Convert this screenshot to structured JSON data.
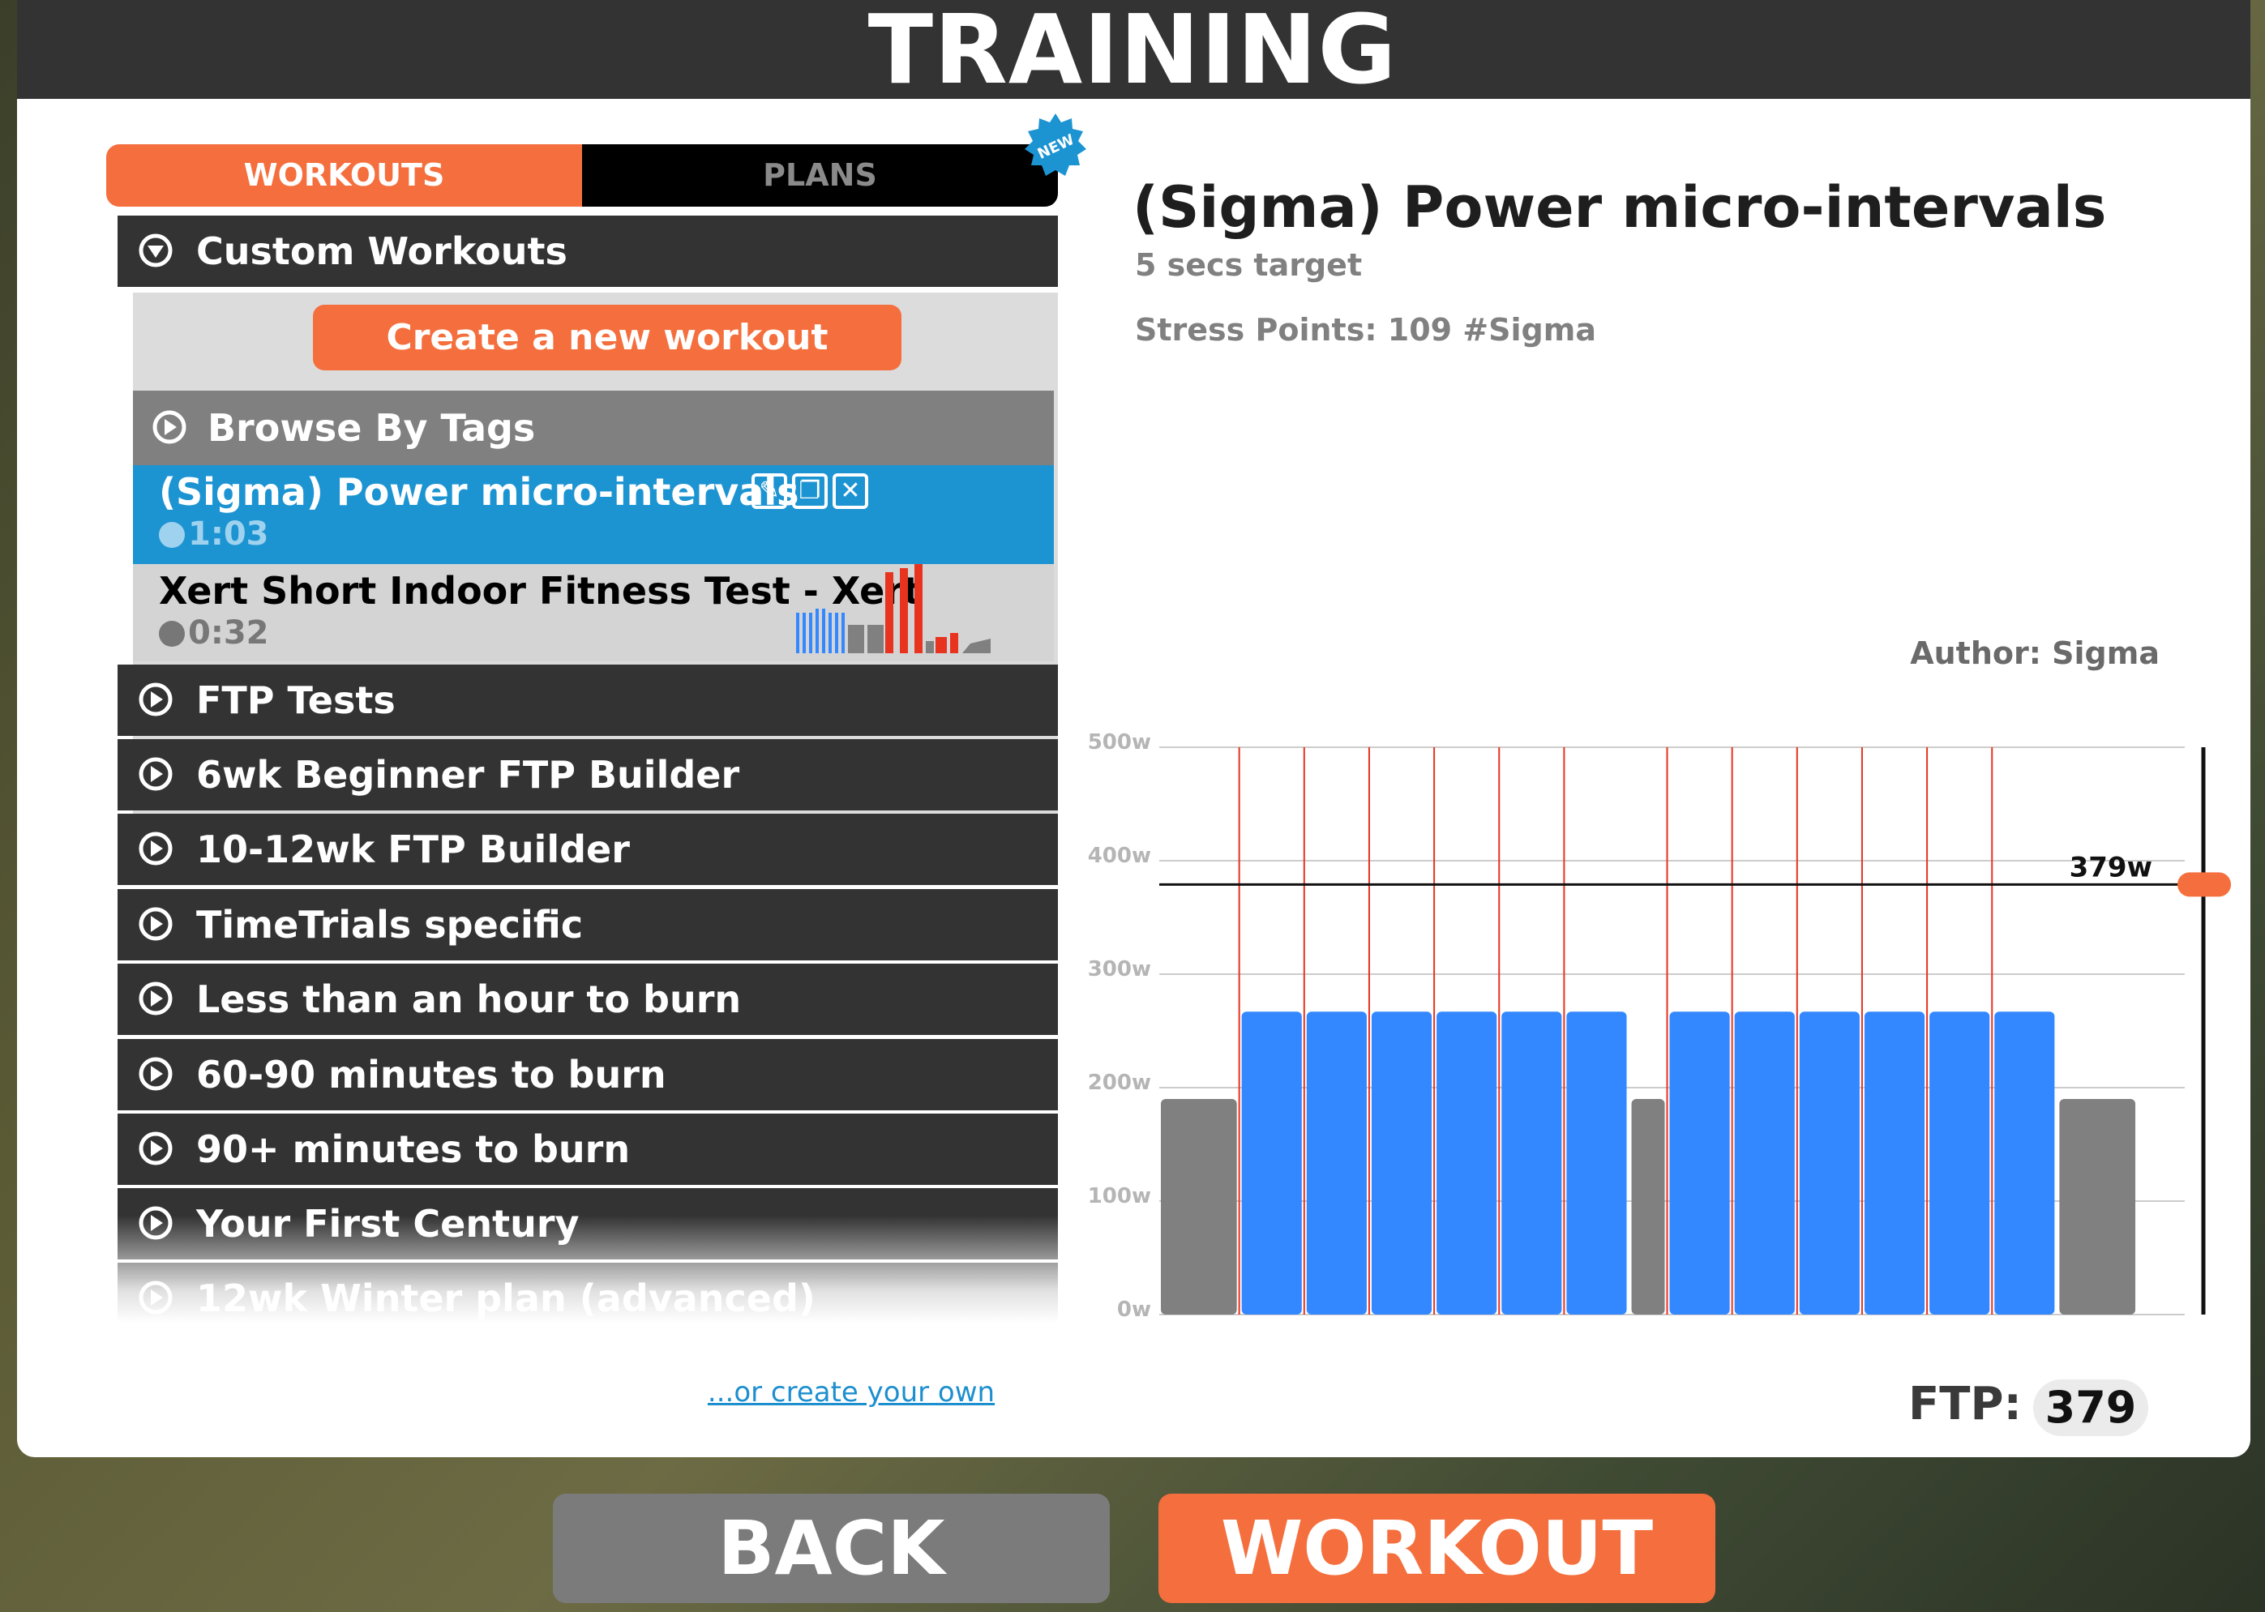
{
  "header": {
    "title": "TRAINING"
  },
  "tabs": {
    "workouts": "WORKOUTS",
    "plans": "PLANS",
    "new_badge": "NEW"
  },
  "custom": {
    "label": "Custom Workouts",
    "create_button": "Create a new workout",
    "browse_tags": "Browse By Tags",
    "selected_workout": {
      "name": "(Sigma) Power micro-intervals",
      "time": "1:03"
    },
    "other_workout": {
      "name": "Xert Short Indoor Fitness Test - Xert",
      "time": "0:32"
    }
  },
  "categories": [
    "FTP Tests",
    "6wk Beginner FTP Builder",
    "10-12wk FTP Builder",
    "TimeTrials specific",
    "Less than an hour to burn",
    "60-90 minutes to burn",
    "90+ minutes to burn",
    "Your First Century",
    "12wk Winter plan (advanced)"
  ],
  "create_link": "...or create your own",
  "details": {
    "title": "(Sigma) Power micro-intervals",
    "target": "5 secs target",
    "stress": "Stress Points: 109  #Sigma",
    "author": "Author: Sigma"
  },
  "ftp": {
    "label": "FTP:",
    "value": "379"
  },
  "buttons": {
    "back": "BACK",
    "workout": "WORKOUT"
  },
  "colors": {
    "accent": "#f46f3d",
    "selected": "#1d94d2",
    "interval": "#3388ff",
    "rest": "#808080",
    "marker": "#e8331f"
  },
  "chart_data": {
    "type": "bar",
    "ylim": [
      0,
      500
    ],
    "y_ticks": [
      "0w",
      "100w",
      "200w",
      "300w",
      "400w",
      "500w"
    ],
    "ftp_line": {
      "value": 379,
      "label": "379w"
    },
    "segments": [
      {
        "power": 190,
        "kind": "rest"
      },
      {
        "power": 267,
        "kind": "interval"
      },
      {
        "power": 267,
        "kind": "interval"
      },
      {
        "power": 267,
        "kind": "interval"
      },
      {
        "power": 267,
        "kind": "interval"
      },
      {
        "power": 267,
        "kind": "interval"
      },
      {
        "power": 267,
        "kind": "interval"
      },
      {
        "power": 190,
        "kind": "rest"
      },
      {
        "power": 267,
        "kind": "interval"
      },
      {
        "power": 267,
        "kind": "interval"
      },
      {
        "power": 267,
        "kind": "interval"
      },
      {
        "power": 267,
        "kind": "interval"
      },
      {
        "power": 267,
        "kind": "interval"
      },
      {
        "power": 267,
        "kind": "interval"
      },
      {
        "power": 190,
        "kind": "rest"
      }
    ]
  }
}
